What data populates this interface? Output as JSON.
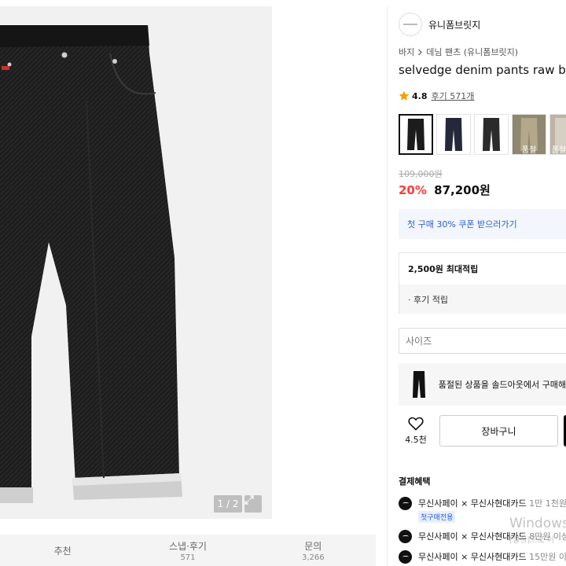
{
  "gallery": {
    "counter": "1 / 2",
    "expand_icon": "expand-icon"
  },
  "tabs": [
    {
      "label": "추천",
      "count": ""
    },
    {
      "label": "스냅·후기",
      "count": "571"
    },
    {
      "label": "문의",
      "count": "3,266"
    }
  ],
  "product": {
    "brand": "유니폼브릿지",
    "breadcrumb": [
      "바지",
      "데님 팬츠 (유니폼브릿지)"
    ],
    "title": "selvedge denim pants raw bl",
    "rating": "4.8",
    "reviews": "후기 571개",
    "colors": [
      {
        "swatch": "#1c1c1c",
        "selected": true,
        "soldout": ""
      },
      {
        "swatch": "#24283a",
        "selected": false,
        "soldout": ""
      },
      {
        "swatch": "#2b2b2b",
        "selected": false,
        "soldout": ""
      },
      {
        "swatch": "#9a8f73",
        "selected": false,
        "soldout": "품절"
      },
      {
        "swatch": "#c8bfb0",
        "selected": false,
        "soldout": "품절"
      }
    ],
    "original_price": "109,000원",
    "discount": "20%",
    "price": "87,200원"
  },
  "coupon": {
    "label": "첫 구매 30% 쿠폰 받으러가기"
  },
  "points": {
    "max": "2,500원 최대적립",
    "review": "· 후기 적립"
  },
  "size": {
    "placeholder": "사이즈"
  },
  "soldout_notice": {
    "text": "품절된 상품을 솔드아웃에서 구매해"
  },
  "actions": {
    "likes": "4.5천",
    "cart": "장바구니"
  },
  "benefits": {
    "title": "결제혜택",
    "items": [
      {
        "text": "무신사페이 × 무신사현대카드",
        "detail": "1만 1천원"
      },
      {
        "text": "무신사페이 × 무신사현대카드",
        "detail": "8만원 이상"
      },
      {
        "text": "무신사페이 × 무신사현대카드",
        "detail": "15만원 이"
      }
    ],
    "first_badge": "첫구매전용"
  },
  "watermark": {
    "line1": "Windows",
    "line2": "[설정]으로 이"
  },
  "colors": {
    "accent_red": "#ff3b3b",
    "link_blue": "#2a5bd7"
  }
}
